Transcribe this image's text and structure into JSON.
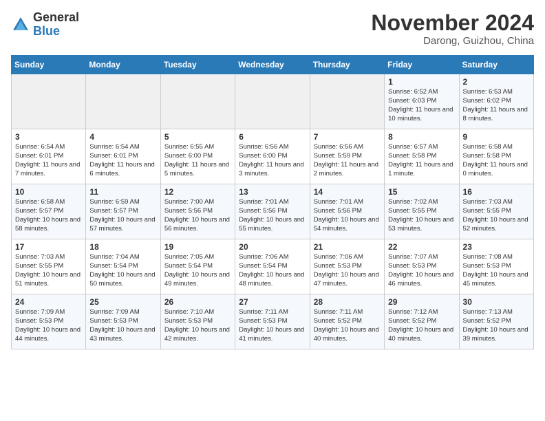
{
  "header": {
    "logo_general": "General",
    "logo_blue": "Blue",
    "month_title": "November 2024",
    "location": "Darong, Guizhou, China"
  },
  "weekdays": [
    "Sunday",
    "Monday",
    "Tuesday",
    "Wednesday",
    "Thursday",
    "Friday",
    "Saturday"
  ],
  "weeks": [
    [
      {
        "day": "",
        "info": ""
      },
      {
        "day": "",
        "info": ""
      },
      {
        "day": "",
        "info": ""
      },
      {
        "day": "",
        "info": ""
      },
      {
        "day": "",
        "info": ""
      },
      {
        "day": "1",
        "info": "Sunrise: 6:52 AM\nSunset: 6:03 PM\nDaylight: 11 hours and 10 minutes."
      },
      {
        "day": "2",
        "info": "Sunrise: 6:53 AM\nSunset: 6:02 PM\nDaylight: 11 hours and 8 minutes."
      }
    ],
    [
      {
        "day": "3",
        "info": "Sunrise: 6:54 AM\nSunset: 6:01 PM\nDaylight: 11 hours and 7 minutes."
      },
      {
        "day": "4",
        "info": "Sunrise: 6:54 AM\nSunset: 6:01 PM\nDaylight: 11 hours and 6 minutes."
      },
      {
        "day": "5",
        "info": "Sunrise: 6:55 AM\nSunset: 6:00 PM\nDaylight: 11 hours and 5 minutes."
      },
      {
        "day": "6",
        "info": "Sunrise: 6:56 AM\nSunset: 6:00 PM\nDaylight: 11 hours and 3 minutes."
      },
      {
        "day": "7",
        "info": "Sunrise: 6:56 AM\nSunset: 5:59 PM\nDaylight: 11 hours and 2 minutes."
      },
      {
        "day": "8",
        "info": "Sunrise: 6:57 AM\nSunset: 5:58 PM\nDaylight: 11 hours and 1 minute."
      },
      {
        "day": "9",
        "info": "Sunrise: 6:58 AM\nSunset: 5:58 PM\nDaylight: 11 hours and 0 minutes."
      }
    ],
    [
      {
        "day": "10",
        "info": "Sunrise: 6:58 AM\nSunset: 5:57 PM\nDaylight: 10 hours and 58 minutes."
      },
      {
        "day": "11",
        "info": "Sunrise: 6:59 AM\nSunset: 5:57 PM\nDaylight: 10 hours and 57 minutes."
      },
      {
        "day": "12",
        "info": "Sunrise: 7:00 AM\nSunset: 5:56 PM\nDaylight: 10 hours and 56 minutes."
      },
      {
        "day": "13",
        "info": "Sunrise: 7:01 AM\nSunset: 5:56 PM\nDaylight: 10 hours and 55 minutes."
      },
      {
        "day": "14",
        "info": "Sunrise: 7:01 AM\nSunset: 5:56 PM\nDaylight: 10 hours and 54 minutes."
      },
      {
        "day": "15",
        "info": "Sunrise: 7:02 AM\nSunset: 5:55 PM\nDaylight: 10 hours and 53 minutes."
      },
      {
        "day": "16",
        "info": "Sunrise: 7:03 AM\nSunset: 5:55 PM\nDaylight: 10 hours and 52 minutes."
      }
    ],
    [
      {
        "day": "17",
        "info": "Sunrise: 7:03 AM\nSunset: 5:55 PM\nDaylight: 10 hours and 51 minutes."
      },
      {
        "day": "18",
        "info": "Sunrise: 7:04 AM\nSunset: 5:54 PM\nDaylight: 10 hours and 50 minutes."
      },
      {
        "day": "19",
        "info": "Sunrise: 7:05 AM\nSunset: 5:54 PM\nDaylight: 10 hours and 49 minutes."
      },
      {
        "day": "20",
        "info": "Sunrise: 7:06 AM\nSunset: 5:54 PM\nDaylight: 10 hours and 48 minutes."
      },
      {
        "day": "21",
        "info": "Sunrise: 7:06 AM\nSunset: 5:53 PM\nDaylight: 10 hours and 47 minutes."
      },
      {
        "day": "22",
        "info": "Sunrise: 7:07 AM\nSunset: 5:53 PM\nDaylight: 10 hours and 46 minutes."
      },
      {
        "day": "23",
        "info": "Sunrise: 7:08 AM\nSunset: 5:53 PM\nDaylight: 10 hours and 45 minutes."
      }
    ],
    [
      {
        "day": "24",
        "info": "Sunrise: 7:09 AM\nSunset: 5:53 PM\nDaylight: 10 hours and 44 minutes."
      },
      {
        "day": "25",
        "info": "Sunrise: 7:09 AM\nSunset: 5:53 PM\nDaylight: 10 hours and 43 minutes."
      },
      {
        "day": "26",
        "info": "Sunrise: 7:10 AM\nSunset: 5:53 PM\nDaylight: 10 hours and 42 minutes."
      },
      {
        "day": "27",
        "info": "Sunrise: 7:11 AM\nSunset: 5:53 PM\nDaylight: 10 hours and 41 minutes."
      },
      {
        "day": "28",
        "info": "Sunrise: 7:11 AM\nSunset: 5:52 PM\nDaylight: 10 hours and 40 minutes."
      },
      {
        "day": "29",
        "info": "Sunrise: 7:12 AM\nSunset: 5:52 PM\nDaylight: 10 hours and 40 minutes."
      },
      {
        "day": "30",
        "info": "Sunrise: 7:13 AM\nSunset: 5:52 PM\nDaylight: 10 hours and 39 minutes."
      }
    ]
  ]
}
